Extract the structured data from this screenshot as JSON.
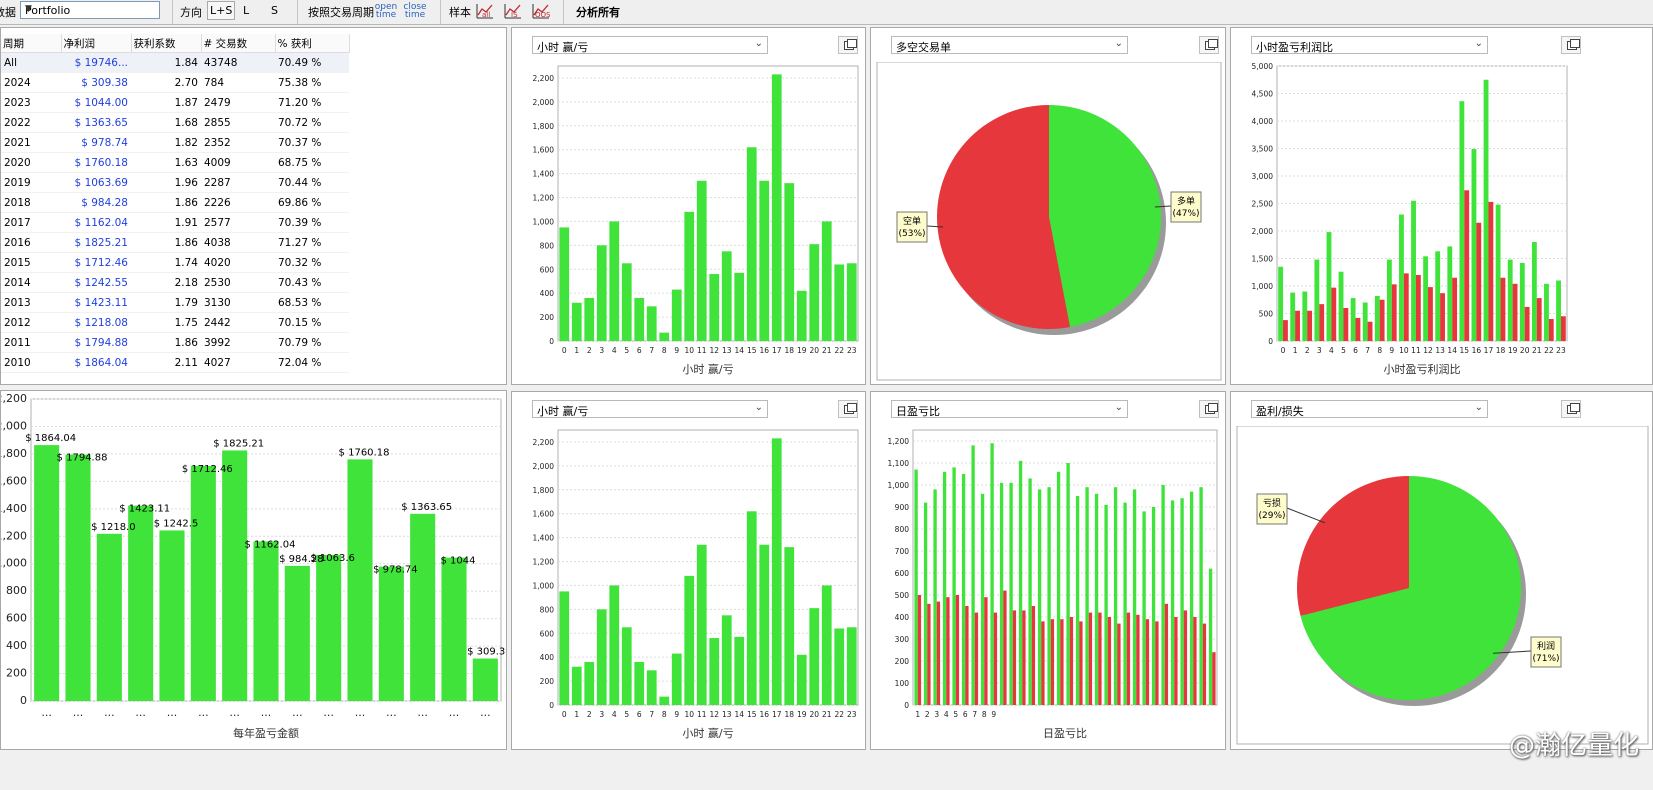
{
  "toolbar": {
    "data_label": "数据",
    "portfolio_value": "Portfolio",
    "direction_label": "方向",
    "dir_ls": "L+S",
    "dir_l": "L",
    "dir_s": "S",
    "trade_period_label": "按照交易周期",
    "open_time": "open time",
    "close_time": "close time",
    "sample_label": "样本",
    "icon_all": "all",
    "icon_is": "IS",
    "icon_oos": "OOS",
    "analyze_all": "分析所有"
  },
  "table": {
    "headers": [
      "周期",
      "净利润",
      "获利系数",
      "# 交易数",
      "% 获利"
    ],
    "rows": [
      [
        "All",
        "$ 19746...",
        "1.84",
        "43748",
        "70.49 %"
      ],
      [
        "2024",
        "$ 309.38",
        "2.70",
        "784",
        "75.38 %"
      ],
      [
        "2023",
        "$ 1044.00",
        "1.87",
        "2479",
        "71.20 %"
      ],
      [
        "2022",
        "$ 1363.65",
        "1.68",
        "2855",
        "70.72 %"
      ],
      [
        "2021",
        "$ 978.74",
        "1.82",
        "2352",
        "70.37 %"
      ],
      [
        "2020",
        "$ 1760.18",
        "1.63",
        "4009",
        "68.75 %"
      ],
      [
        "2019",
        "$ 1063.69",
        "1.96",
        "2287",
        "70.44 %"
      ],
      [
        "2018",
        "$ 984.28",
        "1.86",
        "2226",
        "69.86 %"
      ],
      [
        "2017",
        "$ 1162.04",
        "1.91",
        "2577",
        "70.39 %"
      ],
      [
        "2016",
        "$ 1825.21",
        "1.86",
        "4038",
        "71.27 %"
      ],
      [
        "2015",
        "$ 1712.46",
        "1.74",
        "4020",
        "70.32 %"
      ],
      [
        "2014",
        "$ 1242.55",
        "2.18",
        "2530",
        "70.43 %"
      ],
      [
        "2013",
        "$ 1423.11",
        "1.79",
        "3130",
        "68.53 %"
      ],
      [
        "2012",
        "$ 1218.08",
        "1.75",
        "2442",
        "70.15 %"
      ],
      [
        "2011",
        "$ 1794.88",
        "1.86",
        "3992",
        "70.79 %"
      ],
      [
        "2010",
        "$ 1864.04",
        "2.11",
        "4027",
        "72.04 %"
      ]
    ]
  },
  "panels": {
    "hourly_top": {
      "dropdown": "小时 赢/亏"
    },
    "longshort": {
      "dropdown": "多空交易单"
    },
    "hourly_ratio": {
      "dropdown": "小时盈亏利润比"
    },
    "hourly_bottom": {
      "dropdown": "小时 赢/亏"
    },
    "daily": {
      "dropdown": "日盈亏比"
    },
    "profitloss": {
      "dropdown": "盈利/损失"
    }
  },
  "colors": {
    "green": "#3fe33a",
    "red": "#e5373c",
    "grid": "#dcdcdc"
  },
  "chart_data": [
    {
      "type": "bar",
      "id": "yearly",
      "xlabel": "每年盈亏金额",
      "categories": [
        "...",
        "...",
        "...",
        "...",
        "...",
        "...",
        "...",
        "...",
        "...",
        "...",
        "...",
        "...",
        "...",
        "...",
        "..."
      ],
      "values": [
        1864.04,
        1794.88,
        1218.08,
        1423.11,
        1242.55,
        1712.46,
        1825.21,
        1162.04,
        984.28,
        1063.69,
        1760.18,
        978.74,
        1363.65,
        1044,
        309.38
      ],
      "labels": [
        "$ 1864.04",
        "$ 1794.88",
        "$ 1218.0",
        "$ 1423.11",
        "$ 1242.5",
        "$ 1712.46",
        "$ 1825.21",
        "$ 1162.04",
        "$ 984.28",
        "$ 1063.6",
        "$ 1760.18",
        "$ 978.74",
        "$ 1363.65",
        "$ 1044",
        "$ 309.38"
      ],
      "ylim": [
        0,
        2200
      ],
      "yticks": [
        "0",
        "200",
        "400",
        "600",
        "800",
        "1,000",
        "1,200",
        "1,400",
        "1,600",
        "1,800",
        "2,000",
        "2,200"
      ]
    },
    {
      "type": "bar",
      "id": "hourly_top",
      "xlabel": "小时 赢/亏",
      "categories": [
        "0",
        "1",
        "2",
        "3",
        "4",
        "5",
        "6",
        "7",
        "8",
        "9",
        "10",
        "11",
        "12",
        "13",
        "14",
        "15",
        "16",
        "17",
        "18",
        "19",
        "20",
        "21",
        "22",
        "23"
      ],
      "values": [
        950,
        320,
        360,
        800,
        1000,
        650,
        360,
        290,
        70,
        430,
        1080,
        1340,
        560,
        750,
        570,
        1620,
        1340,
        2230,
        1320,
        420,
        810,
        1000,
        640,
        650
      ],
      "ylim": [
        0,
        2300
      ],
      "yticks": [
        "0",
        "200",
        "400",
        "600",
        "800",
        "1,000",
        "1,200",
        "1,400",
        "1,600",
        "1,800",
        "2,000",
        "2,200"
      ]
    },
    {
      "type": "pie",
      "id": "longshort",
      "slices": [
        {
          "name": "多单",
          "value": 47,
          "label": "(47%)"
        },
        {
          "name": "空单",
          "value": 53,
          "label": "(53%)"
        }
      ]
    },
    {
      "type": "bar",
      "id": "hourly_ratio",
      "xlabel": "小时盈亏利润比",
      "categories": [
        "0",
        "1",
        "2",
        "3",
        "4",
        "5",
        "6",
        "7",
        "8",
        "9",
        "10",
        "11",
        "12",
        "13",
        "14",
        "15",
        "16",
        "17",
        "18",
        "19",
        "20",
        "21",
        "22",
        "23"
      ],
      "series": [
        {
          "color": "green",
          "values": [
            1350,
            880,
            900,
            1480,
            1980,
            1260,
            780,
            700,
            820,
            1480,
            2300,
            2550,
            1540,
            1630,
            1720,
            4360,
            3490,
            4750,
            2480,
            1480,
            1420,
            1800,
            1040,
            1100
          ]
        },
        {
          "color": "red",
          "values": [
            380,
            550,
            550,
            670,
            970,
            600,
            420,
            350,
            750,
            1030,
            1230,
            1200,
            980,
            870,
            1150,
            2740,
            2150,
            2530,
            1150,
            1040,
            620,
            780,
            400,
            450
          ]
        }
      ],
      "ylim": [
        0,
        5000
      ],
      "yticks": [
        "0",
        "500",
        "1,000",
        "1,500",
        "2,000",
        "2,500",
        "3,000",
        "3,500",
        "4,000",
        "4,500",
        "5,000"
      ]
    },
    {
      "type": "bar",
      "id": "hourly_bottom",
      "xlabel": "小时 赢/亏",
      "categories": [
        "0",
        "1",
        "2",
        "3",
        "4",
        "5",
        "6",
        "7",
        "8",
        "9",
        "10",
        "11",
        "12",
        "13",
        "14",
        "15",
        "16",
        "17",
        "18",
        "19",
        "20",
        "21",
        "22",
        "23"
      ],
      "values": [
        950,
        320,
        360,
        800,
        1000,
        650,
        360,
        290,
        70,
        430,
        1080,
        1340,
        560,
        750,
        570,
        1620,
        1340,
        2230,
        1320,
        420,
        810,
        1000,
        640,
        650
      ],
      "ylim": [
        0,
        2300
      ],
      "yticks": [
        "0",
        "200",
        "400",
        "600",
        "800",
        "1,000",
        "1,200",
        "1,400",
        "1,600",
        "1,800",
        "2,000",
        "2,200"
      ]
    },
    {
      "type": "bar",
      "id": "daily",
      "xlabel": "日盈亏比",
      "categories": [
        "1",
        "2",
        "3",
        "4",
        "5",
        "6",
        "7",
        "8",
        "9",
        "",
        "",
        "",
        "",
        "",
        "",
        "",
        "",
        "",
        "",
        "",
        "",
        "",
        "",
        "",
        "",
        "",
        "",
        "",
        "",
        "",
        "",
        ""
      ],
      "series": [
        {
          "color": "green",
          "values": [
            1070,
            920,
            980,
            1060,
            1080,
            1050,
            1180,
            960,
            1190,
            1010,
            1010,
            1110,
            1030,
            980,
            990,
            1060,
            1100,
            950,
            990,
            960,
            910,
            990,
            920,
            980,
            880,
            900,
            1000,
            930,
            940,
            970,
            990,
            620
          ]
        },
        {
          "color": "red",
          "values": [
            500,
            460,
            470,
            490,
            500,
            450,
            420,
            490,
            420,
            520,
            430,
            430,
            450,
            380,
            390,
            390,
            400,
            380,
            420,
            420,
            400,
            370,
            420,
            410,
            390,
            380,
            460,
            400,
            430,
            400,
            370,
            240
          ]
        }
      ],
      "ylim": [
        0,
        1250
      ],
      "yticks": [
        "0",
        "100",
        "200",
        "300",
        "400",
        "500",
        "600",
        "700",
        "800",
        "900",
        "1,000",
        "1,100",
        "1,200"
      ]
    },
    {
      "type": "pie",
      "id": "profitloss",
      "slices": [
        {
          "name": "利润",
          "value": 71,
          "label": "(71%)"
        },
        {
          "name": "亏损",
          "value": 29,
          "label": "(29%)"
        }
      ]
    }
  ],
  "watermark": "@瀚亿量化"
}
